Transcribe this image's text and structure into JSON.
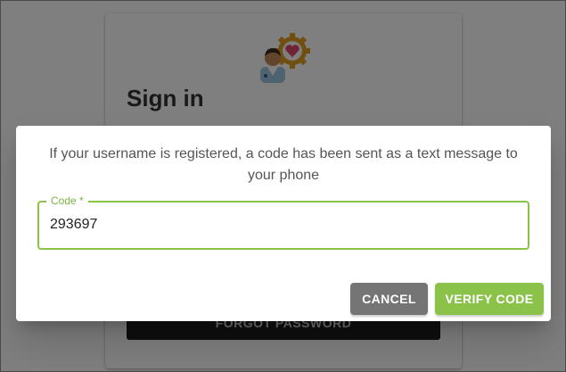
{
  "card": {
    "title": "Sign in",
    "forgot_label": "FORGOT PASSWORD",
    "logo_icon": "doctor-gear-heart-icon"
  },
  "dialog": {
    "message": "If your username is registered, a code has been sent as a text message to your phone",
    "code_field": {
      "label": "Code *",
      "value": "293697"
    },
    "cancel_label": "CANCEL",
    "verify_label": "VERIFY CODE"
  },
  "colors": {
    "accent": "#8bc34a",
    "cancel": "#757575"
  }
}
